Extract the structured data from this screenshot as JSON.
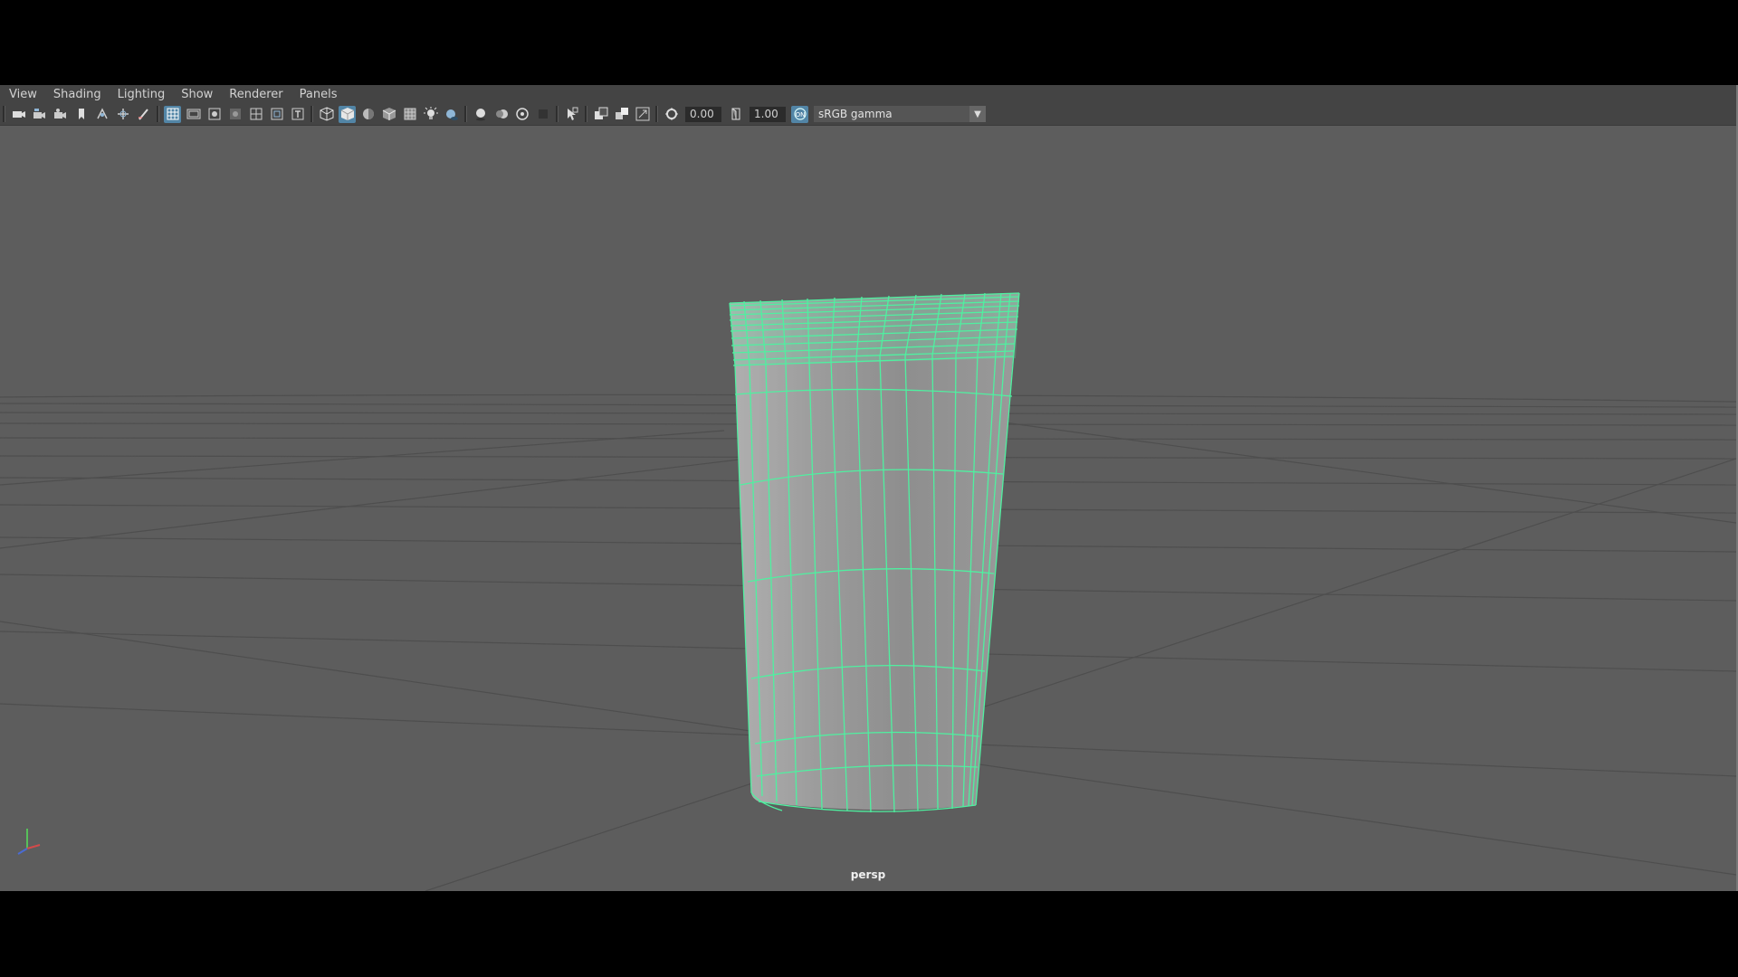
{
  "menu": [
    "View",
    "Shading",
    "Lighting",
    "Show",
    "Renderer",
    "Panels"
  ],
  "toolbar": {
    "exposure_value": "0.00",
    "gamma_value": "1.00",
    "colorspace_label": "sRGB gamma"
  },
  "viewport": {
    "camera_label": "persp"
  },
  "icons": [
    "camera-icon",
    "camera-attributes-icon",
    "bookmark-icon",
    "image-plane-icon",
    "grid-icon",
    "film-gate-icon",
    "resolution-gate-icon",
    "gate-mask-icon",
    "field-chart-icon",
    "safe-action-icon",
    "safe-title-icon",
    "wireframe-icon",
    "smooth-shade-icon",
    "default-material-icon",
    "wireframe-on-shaded-icon",
    "xray-icon",
    "use-all-lights-icon",
    "shadows-icon",
    "screen-space-ao-icon",
    "motion-blur-icon",
    "anti-aliasing-icon",
    "depth-of-field-icon",
    "isolate-select-icon",
    "xray-joints-icon",
    "xray-active-icon",
    "backface-culling-icon",
    "exposure-icon",
    "gamma-icon",
    "color-management-icon",
    "dropdown-arrow-icon",
    "axis-gizmo-icon"
  ],
  "colors": {
    "viewport_bg": "#5d5d5d",
    "selection_wireframe": "#4ff0a0",
    "panel_bar": "#444444",
    "active_button": "#5285a6"
  }
}
